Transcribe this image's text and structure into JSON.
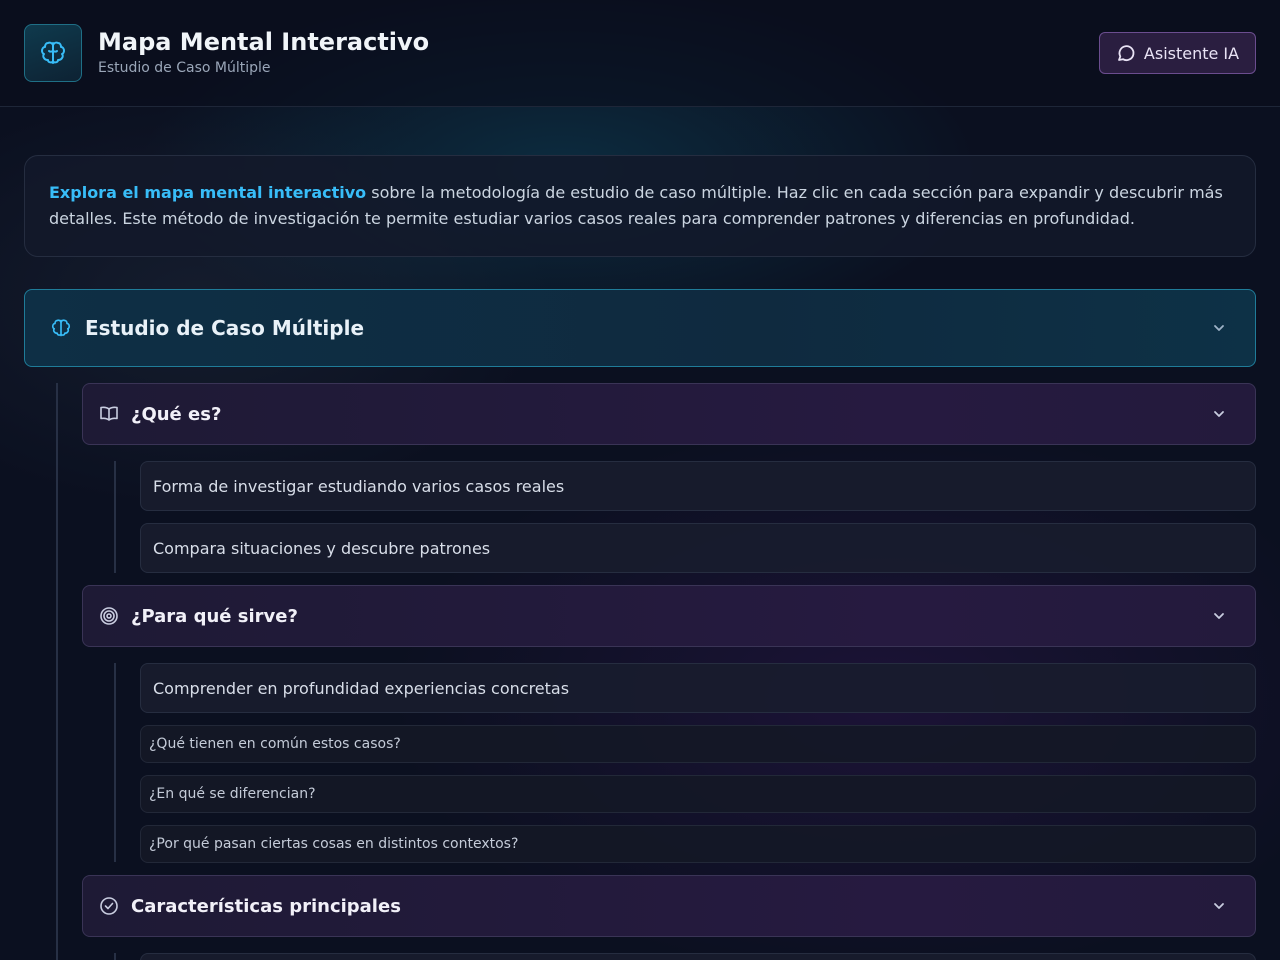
{
  "header": {
    "title": "Mapa Mental Interactivo",
    "subtitle": "Estudio de Caso Múltiple",
    "ai_button_label": "Asistente IA"
  },
  "intro": {
    "highlight": "Explora el mapa mental interactivo",
    "text": " sobre la metodología de estudio de caso múltiple. Haz clic en cada sección para expandir y descubrir más detalles. Este método de investigación te permite estudiar varios casos reales para comprender patrones y diferencias en profundidad."
  },
  "root": {
    "title": "Estudio de Caso Múltiple",
    "icon": "brain-icon"
  },
  "sections": [
    {
      "title": "¿Qué es?",
      "icon": "book-open-icon",
      "items": [
        "Forma de investigar estudiando varios casos reales",
        "Compara situaciones y descubre patrones"
      ]
    },
    {
      "title": "¿Para qué sirve?",
      "icon": "target-icon",
      "items": [
        "Comprender en profundidad experiencias concretas"
      ],
      "questions": [
        "¿Qué tienen en común estos casos?",
        "¿En qué se diferencian?",
        "¿Por qué pasan ciertas cosas en distintos contextos?"
      ]
    },
    {
      "title": "Características principales",
      "icon": "check-circle-icon",
      "items": []
    }
  ],
  "colors": {
    "accent_cyan": "#38bdf8",
    "section_border": "#3a3456",
    "background": "#0b1020"
  }
}
